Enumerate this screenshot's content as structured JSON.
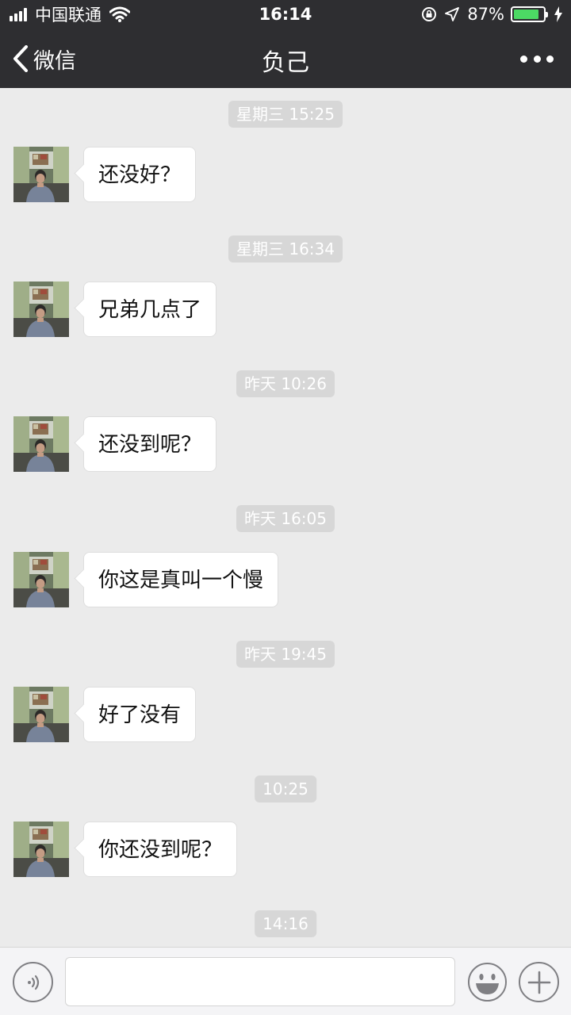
{
  "status_bar": {
    "carrier": "中国联通",
    "time": "16:14",
    "battery_text": "87%",
    "battery_level_percent": 87,
    "battery_color": "#4cd964"
  },
  "nav": {
    "back_label": "微信",
    "title": "负己",
    "more_icon": "more-dots-icon"
  },
  "messages": [
    {
      "time": "星期三 15:25",
      "text": "还没好？"
    },
    {
      "time": "星期三 16:34",
      "text": "兄弟几点了"
    },
    {
      "time": "昨天 10:26",
      "text": "还没到呢？"
    },
    {
      "time": "昨天 16:05",
      "text": "你这是真叫一个慢"
    },
    {
      "time": "昨天 19:45",
      "text": "好了没有"
    },
    {
      "time": "10:25",
      "text": "你还没到呢？"
    }
  ],
  "last_time": "14:16",
  "input_bar": {
    "voice_icon": "voice-icon",
    "input_value": "",
    "emoji_icon": "emoji-icon",
    "plus_icon": "plus-icon"
  },
  "colors": {
    "bar_background": "#2e2e31",
    "chat_background": "#ebebeb",
    "timestamp_chip": "#d7d7d7"
  }
}
